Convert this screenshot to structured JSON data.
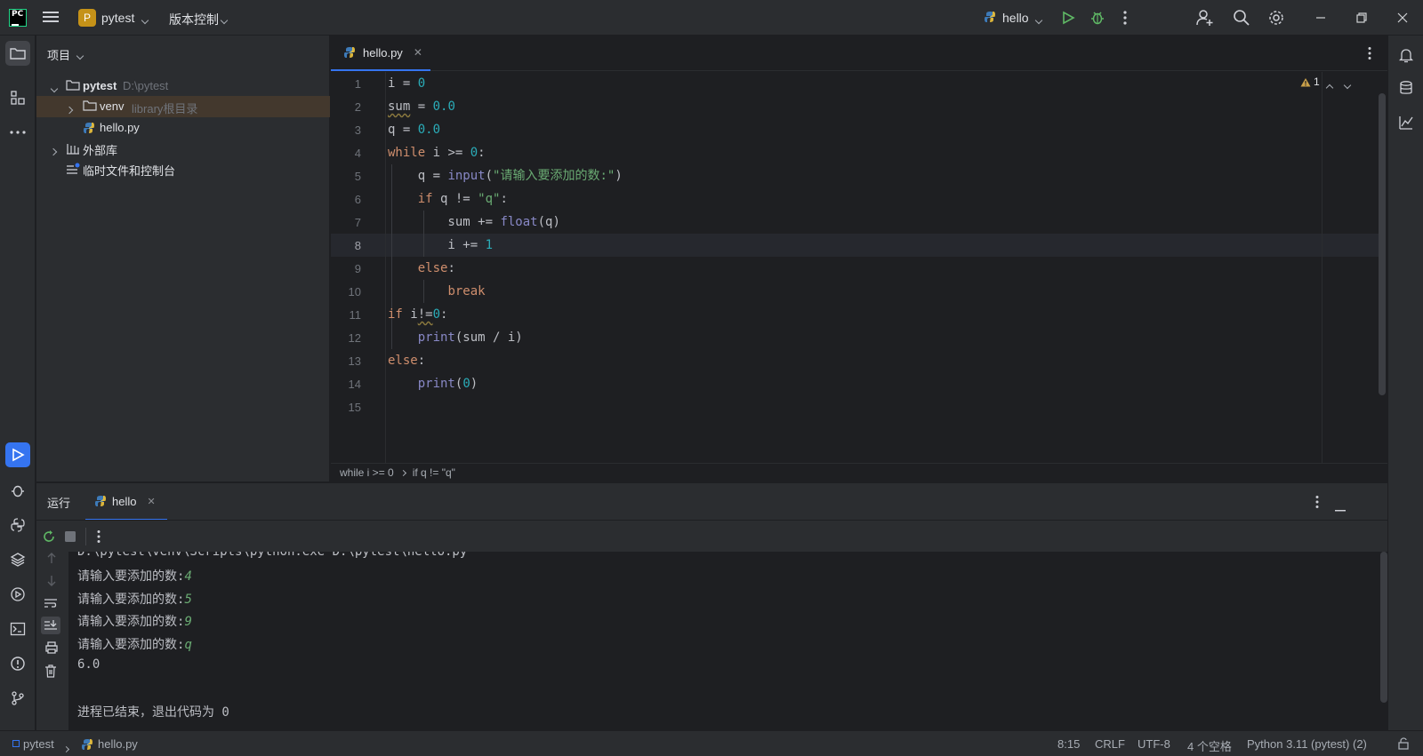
{
  "titlebar": {
    "project_letter": "P",
    "project_name": "pytest",
    "vcs_menu": "版本控制",
    "run_config": "hello"
  },
  "project_panel": {
    "title": "项目",
    "items": [
      {
        "label": "pytest",
        "hint": "D:\\pytest"
      },
      {
        "label": "venv",
        "hint": "library根目录"
      },
      {
        "label": "hello.py",
        "hint": ""
      },
      {
        "label": "外部库",
        "hint": ""
      },
      {
        "label": "临时文件和控制台",
        "hint": ""
      }
    ]
  },
  "editor": {
    "tab_label": "hello.py",
    "warnings": "1",
    "line_numbers": [
      "1",
      "2",
      "3",
      "4",
      "5",
      "6",
      "7",
      "8",
      "9",
      "10",
      "11",
      "12",
      "13",
      "14",
      "15"
    ],
    "current_line": 8,
    "breadcrumb": [
      "while i >= 0",
      "if q != \"q\""
    ]
  },
  "run_panel": {
    "title": "运行",
    "tab_label": "hello",
    "console": [
      {
        "text": "D:\\pytest\\venv\\Scripts\\python.exe D:\\pytest\\hello.py",
        "input": ""
      },
      {
        "text": "请输入要添加的数:",
        "input": "4"
      },
      {
        "text": "请输入要添加的数:",
        "input": "5"
      },
      {
        "text": "请输入要添加的数:",
        "input": "9"
      },
      {
        "text": "请输入要添加的数:",
        "input": "q"
      },
      {
        "text": "6.0",
        "input": ""
      },
      {
        "text": "",
        "input": ""
      },
      {
        "text": "进程已结束，退出代码为 0",
        "input": ""
      }
    ]
  },
  "statusbar": {
    "crumb_project": "pytest",
    "crumb_file": "hello.py",
    "position": "8:15",
    "line_sep": "CRLF",
    "encoding": "UTF-8",
    "indent": "4 个空格",
    "interpreter": "Python 3.11 (pytest) (2)"
  },
  "colors": {
    "accent": "#3574f0",
    "keyword": "#cf8e6d",
    "number": "#2aacb8",
    "string": "#6aab73",
    "builtin": "#8888c6"
  }
}
